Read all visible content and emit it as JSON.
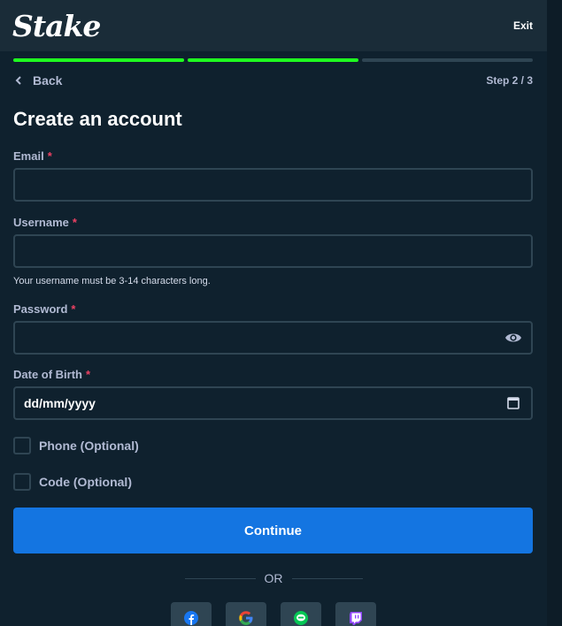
{
  "header": {
    "logo": "Stake",
    "exit_label": "Exit"
  },
  "progress": {
    "current_step": 2,
    "total_steps": 3
  },
  "nav": {
    "back_label": "Back",
    "step_label": "Step 2 / 3"
  },
  "page_title": "Create an account",
  "form": {
    "email": {
      "label": "Email",
      "required_mark": "*",
      "value": ""
    },
    "username": {
      "label": "Username",
      "required_mark": "*",
      "value": "",
      "hint": "Your username must be 3-14 characters long."
    },
    "password": {
      "label": "Password",
      "required_mark": "*",
      "value": ""
    },
    "dob": {
      "label": "Date of Birth",
      "required_mark": "*",
      "placeholder": "dd/mm/yyyy"
    },
    "phone_optional": {
      "label": "Phone (Optional)",
      "checked": false
    },
    "code_optional": {
      "label": "Code (Optional)",
      "checked": false
    }
  },
  "continue_label": "Continue",
  "divider_label": "OR",
  "socials": [
    {
      "name": "facebook",
      "icon": "facebook-icon",
      "color": "#1877f2"
    },
    {
      "name": "google",
      "icon": "google-icon",
      "color": "#ea4335"
    },
    {
      "name": "line",
      "icon": "line-icon",
      "color": "#06c755"
    },
    {
      "name": "twitch",
      "icon": "twitch-icon",
      "color": "#9146ff"
    }
  ],
  "colors": {
    "background": "#0f212e",
    "header": "#1a2c38",
    "progress_done": "#1fff20",
    "progress_todo": "#2f4553",
    "primary_button": "#1475e1",
    "required": "#ed4163"
  }
}
